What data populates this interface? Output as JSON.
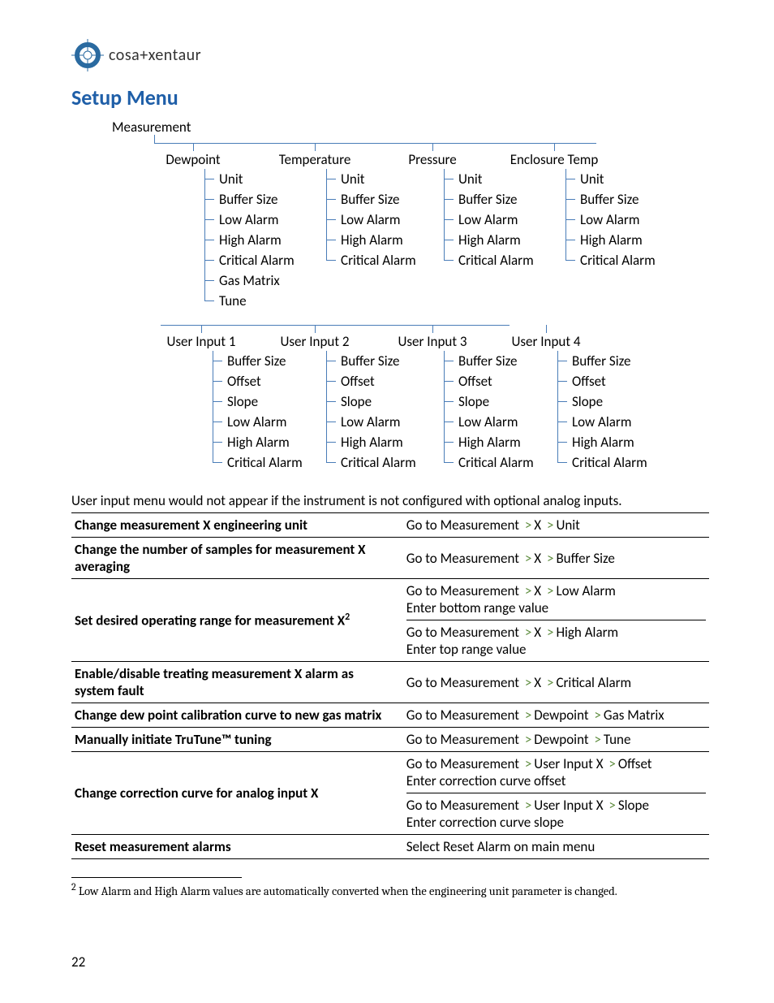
{
  "logo_text": "cosa+xentaur",
  "title": "Setup Menu",
  "root": "Measurement",
  "branches1": [
    {
      "label": "Dewpoint",
      "items": [
        "Unit",
        "Buffer Size",
        "Low Alarm",
        "High Alarm",
        "Critical Alarm",
        "Gas Matrix",
        "Tune"
      ]
    },
    {
      "label": "Temperature",
      "items": [
        "Unit",
        "Buffer Size",
        "Low Alarm",
        "High Alarm",
        "Critical Alarm"
      ]
    },
    {
      "label": "Pressure",
      "items": [
        "Unit",
        "Buffer Size",
        "Low Alarm",
        "High Alarm",
        "Critical Alarm"
      ]
    },
    {
      "label": "Enclosure Temp",
      "items": [
        "Unit",
        "Buffer Size",
        "Low Alarm",
        "High Alarm",
        "Critical Alarm"
      ]
    }
  ],
  "branches2": [
    {
      "label": "User Input 1",
      "items": [
        "Buffer Size",
        "Offset",
        "Slope",
        "Low Alarm",
        "High Alarm",
        "Critical Alarm"
      ]
    },
    {
      "label": "User Input 2",
      "items": [
        "Buffer Size",
        "Offset",
        "Slope",
        "Low Alarm",
        "High Alarm",
        "Critical Alarm"
      ]
    },
    {
      "label": "User Input 3",
      "items": [
        "Buffer Size",
        "Offset",
        "Slope",
        "Low Alarm",
        "High Alarm",
        "Critical Alarm"
      ]
    },
    {
      "label": "User Input 4",
      "items": [
        "Buffer Size",
        "Offset",
        "Slope",
        "Low Alarm",
        "High Alarm",
        "Critical Alarm"
      ]
    }
  ],
  "note": "User input menu would not appear if the instrument is not configured with optional analog inputs.",
  "rows": [
    {
      "lhs": "Change measurement X engineering unit",
      "rhs": [
        {
          "path": [
            "Go to Measurement",
            "X",
            "Unit"
          ]
        }
      ]
    },
    {
      "lhs": "Change the number of samples for measurement X averaging",
      "rhs": [
        {
          "path": [
            "Go to Measurement",
            "X",
            "Buffer Size"
          ]
        }
      ]
    },
    {
      "lhs": "Set desired operating range for measurement X",
      "sup": "2",
      "rhs": [
        {
          "path": [
            "Go to Measurement",
            "X",
            "Low Alarm"
          ],
          "extra": "Enter bottom range value"
        },
        {
          "path": [
            "Go to Measurement",
            "X",
            "High Alarm"
          ],
          "extra": "Enter top range value"
        }
      ]
    },
    {
      "lhs": "Enable/disable treating measurement X alarm as system fault",
      "rhs": [
        {
          "path": [
            "Go to Measurement",
            "X",
            "Critical Alarm"
          ]
        }
      ]
    },
    {
      "lhs": "Change dew point calibration curve to new gas matrix",
      "rhs": [
        {
          "path": [
            "Go to Measurement",
            "Dewpoint",
            "Gas Matrix"
          ]
        }
      ]
    },
    {
      "lhs": "Manually initiate TruTune™ tuning",
      "rhs": [
        {
          "path": [
            "Go to Measurement",
            "Dewpoint",
            "Tune"
          ]
        }
      ]
    },
    {
      "lhs": "Change correction curve for analog input X",
      "rhs": [
        {
          "path": [
            "Go to Measurement",
            "User Input X",
            "Offset"
          ],
          "extra": "Enter correction curve offset"
        },
        {
          "path": [
            "Go to Measurement",
            "User Input X",
            "Slope"
          ],
          "extra": "Enter correction curve slope"
        }
      ]
    },
    {
      "lhs": "Reset measurement alarms",
      "rhs": [
        {
          "text": "Select Reset Alarm on main menu"
        }
      ]
    }
  ],
  "footnote_num": "2",
  "footnote": " Low Alarm and High Alarm values are automatically converted when the engineering unit parameter is changed.",
  "page_number": "22"
}
